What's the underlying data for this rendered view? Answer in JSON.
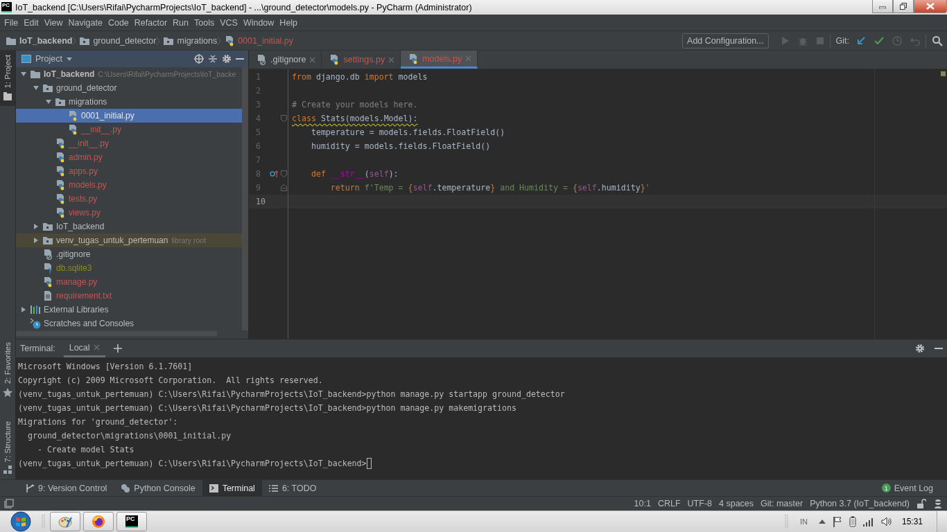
{
  "window": {
    "logo": "PC",
    "title": "IoT_backend [C:\\Users\\Rifai\\PycharmProjects\\IoT_backend] - ...\\ground_detector\\models.py - PyCharm (Administrator)"
  },
  "menu": [
    "File",
    "Edit",
    "View",
    "Navigate",
    "Code",
    "Refactor",
    "Run",
    "Tools",
    "VCS",
    "Window",
    "Help"
  ],
  "breadcrumbs": [
    {
      "label": "IoT_backend",
      "kind": "root",
      "color": "#bbbbbb"
    },
    {
      "label": "ground_detector",
      "kind": "folder",
      "color": "#bbbbbb"
    },
    {
      "label": "migrations",
      "kind": "folder",
      "color": "#bbbbbb"
    },
    {
      "label": "0001_initial.py",
      "kind": "python",
      "color": "#c75450"
    }
  ],
  "toolbar": {
    "run_config": "Add Configuration...",
    "git_label": "Git:"
  },
  "side_tabs_top": [
    {
      "label": "1: Project",
      "kind": "project",
      "selected": true
    }
  ],
  "side_tabs_bottom": [
    {
      "label": "2: Favorites",
      "kind": "favorites",
      "selected": false
    },
    {
      "label": "7: Structure",
      "kind": "structure",
      "selected": false
    }
  ],
  "project": {
    "title": "Project",
    "tree": [
      {
        "label": "IoT_backend",
        "kind": "root",
        "hint": "C:\\Users\\Rifai\\PycharmProjects\\IoT_backe",
        "color": "#bbbbbb",
        "expanded": true,
        "selected": false,
        "highlighted": false,
        "children": [
          {
            "label": "ground_detector",
            "kind": "folder",
            "color": "#bbbbbb",
            "expanded": true,
            "selected": false,
            "highlighted": false,
            "children": [
              {
                "label": "migrations",
                "kind": "folder",
                "color": "#bbbbbb",
                "expanded": true,
                "selected": false,
                "highlighted": false,
                "children": [
                  {
                    "label": "0001_initial.py",
                    "kind": "python",
                    "color": "#e8e8e8",
                    "selected": true,
                    "highlighted": false
                  },
                  {
                    "label": "__init__.py",
                    "kind": "python",
                    "color": "#c75450",
                    "selected": false,
                    "highlighted": false
                  }
                ]
              },
              {
                "label": "__init__.py",
                "kind": "python",
                "color": "#c75450",
                "selected": false,
                "highlighted": false
              },
              {
                "label": "admin.py",
                "kind": "python",
                "color": "#c75450",
                "selected": false,
                "highlighted": false
              },
              {
                "label": "apps.py",
                "kind": "python",
                "color": "#c75450",
                "selected": false,
                "highlighted": false
              },
              {
                "label": "models.py",
                "kind": "python",
                "color": "#c75450",
                "selected": false,
                "highlighted": false
              },
              {
                "label": "tests.py",
                "kind": "python",
                "color": "#c75450",
                "selected": false,
                "highlighted": false
              },
              {
                "label": "views.py",
                "kind": "python",
                "color": "#c75450",
                "selected": false,
                "highlighted": false
              }
            ]
          },
          {
            "label": "IoT_backend",
            "kind": "folder",
            "color": "#bbbbbb",
            "expanded": false,
            "selected": false,
            "highlighted": false
          },
          {
            "label": "venv_tugas_untuk_pertemuan",
            "kind": "folder",
            "hint": "library root",
            "color": "#bbbbbb",
            "expanded": false,
            "selected": false,
            "highlighted": true
          },
          {
            "label": ".gitignore",
            "kind": "gitignore",
            "color": "#bbbbbb",
            "selected": false,
            "highlighted": false
          },
          {
            "label": "db.sqlite3",
            "kind": "unknown",
            "color": "#8c8c1e",
            "selected": false,
            "highlighted": false
          },
          {
            "label": "manage.py",
            "kind": "python",
            "color": "#c75450",
            "selected": false,
            "highlighted": false
          },
          {
            "label": "requirement.txt",
            "kind": "text",
            "color": "#c75450",
            "selected": false,
            "highlighted": false
          }
        ]
      },
      {
        "label": "External Libraries",
        "kind": "libraries",
        "color": "#bbbbbb",
        "expanded": false,
        "selected": false,
        "highlighted": false
      },
      {
        "label": "Scratches and Consoles",
        "kind": "scratches",
        "color": "#bbbbbb",
        "selected": false,
        "highlighted": false
      }
    ]
  },
  "editor": {
    "tabs": [
      {
        "label": ".gitignore",
        "kind": "gitignore",
        "color": "#bbbbbb",
        "selected": false
      },
      {
        "label": "settings.py",
        "kind": "python",
        "color": "#c75450",
        "selected": false
      },
      {
        "label": "models.py",
        "kind": "python",
        "color": "#c75450",
        "selected": true
      }
    ],
    "lines": [
      {
        "number": "1",
        "current": false,
        "warning": false,
        "fold_start": false,
        "fold_end": false,
        "override": false,
        "tokens": [
          {
            "text": "from",
            "kind": "kw"
          },
          {
            "text": " django.db ",
            "kind": "plain"
          },
          {
            "text": "import",
            "kind": "kw"
          },
          {
            "text": " models",
            "kind": "plain"
          }
        ]
      },
      {
        "number": "2",
        "current": false,
        "warning": false,
        "fold_start": false,
        "fold_end": false,
        "override": false
      },
      {
        "number": "3",
        "current": false,
        "warning": false,
        "fold_start": false,
        "fold_end": false,
        "override": false,
        "tokens": [
          {
            "text": "# Create your models here.",
            "kind": "comment"
          }
        ]
      },
      {
        "number": "4",
        "current": false,
        "warning": true,
        "fold_start": true,
        "fold_end": false,
        "override": false,
        "tokens": [
          {
            "text": "class",
            "kind": "kw"
          },
          {
            "text": " Stats(models.Model):",
            "kind": "plain"
          }
        ]
      },
      {
        "number": "5",
        "current": false,
        "warning": false,
        "fold_start": false,
        "fold_end": false,
        "override": false,
        "tokens": [
          {
            "text": "    temperature = models.fields.FloatField()",
            "kind": "plain"
          }
        ]
      },
      {
        "number": "6",
        "current": false,
        "warning": false,
        "fold_start": false,
        "fold_end": false,
        "override": false,
        "tokens": [
          {
            "text": "    humidity = models.fields.FloatField()",
            "kind": "plain"
          }
        ]
      },
      {
        "number": "7",
        "current": false,
        "warning": false,
        "fold_start": false,
        "fold_end": false,
        "override": false
      },
      {
        "number": "8",
        "current": false,
        "warning": false,
        "fold_start": true,
        "fold_end": false,
        "override": true,
        "tokens": [
          {
            "text": "    def",
            "kind": "kw"
          },
          {
            "text": " __str__",
            "kind": "magic"
          },
          {
            "text": "(",
            "kind": "plain"
          },
          {
            "text": "self",
            "kind": "self"
          },
          {
            "text": "):",
            "kind": "plain"
          }
        ]
      },
      {
        "number": "9",
        "current": false,
        "warning": false,
        "fold_start": false,
        "fold_end": true,
        "override": false,
        "tokens": [
          {
            "text": "        return",
            "kind": "kw"
          },
          {
            "text": " f'Temp = ",
            "kind": "str"
          },
          {
            "text": "{",
            "kind": "brace"
          },
          {
            "text": "self",
            "kind": "self"
          },
          {
            "text": ".temperature",
            "kind": "plain"
          },
          {
            "text": "}",
            "kind": "brace"
          },
          {
            "text": " and Humidity = ",
            "kind": "str"
          },
          {
            "text": "{",
            "kind": "brace"
          },
          {
            "text": "self",
            "kind": "self"
          },
          {
            "text": ".humidity",
            "kind": "plain"
          },
          {
            "text": "}",
            "kind": "brace"
          },
          {
            "text": "'",
            "kind": "str"
          }
        ]
      },
      {
        "number": "10",
        "current": true,
        "warning": false,
        "fold_start": false,
        "fold_end": false,
        "override": false
      }
    ]
  },
  "terminal": {
    "label": "Terminal:",
    "tabs": [
      {
        "label": "Local",
        "selected": true
      }
    ],
    "lines": [
      "Microsoft Windows [Version 6.1.7601]",
      "Copyright (c) 2009 Microsoft Corporation.  All rights reserved.",
      "(venv_tugas_untuk_pertemuan) C:\\Users\\Rifai\\PycharmProjects\\IoT_backend>python manage.py startapp ground_detector",
      "(venv_tugas_untuk_pertemuan) C:\\Users\\Rifai\\PycharmProjects\\IoT_backend>python manage.py makemigrations",
      "Migrations for 'ground_detector':",
      "  ground_detector\\migrations\\0001_initial.py",
      "    - Create model Stats",
      "(venv_tugas_untuk_pertemuan) C:\\Users\\Rifai\\PycharmProjects\\IoT_backend>"
    ]
  },
  "tool_tabs": [
    {
      "label": "9: Version Control",
      "kind": "vcs",
      "selected": false
    },
    {
      "label": "Python Console",
      "kind": "python",
      "selected": false
    },
    {
      "label": "Terminal",
      "kind": "terminal",
      "selected": true
    },
    {
      "label": "6: TODO",
      "kind": "todo",
      "selected": false
    }
  ],
  "event_log": {
    "count": "1",
    "label": "Event Log"
  },
  "status_bar": {
    "items": [
      "10:1",
      "CRLF",
      "UTF-8",
      "4 spaces",
      "Git: master",
      "Python 3.7 (IoT_backend)"
    ]
  },
  "taskbar": {
    "apps": [
      {
        "kind": "paint"
      },
      {
        "kind": "firefox"
      },
      {
        "kind": "pycharm",
        "logo": "PC"
      }
    ],
    "language": "IN",
    "clock": "15:31"
  }
}
